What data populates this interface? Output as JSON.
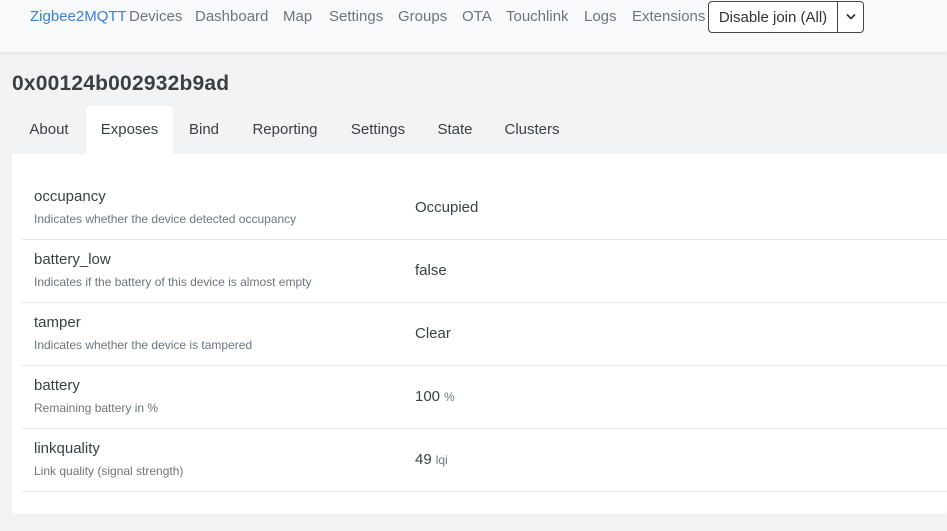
{
  "navbar": {
    "brand": "Zigbee2MQTT",
    "items": [
      "Devices",
      "Dashboard",
      "Map",
      "Settings",
      "Groups",
      "OTA",
      "Touchlink",
      "Logs",
      "Extensions"
    ],
    "join_button_label": "Disable join (All)",
    "join_caret_icon": "chevron-down-icon"
  },
  "device": {
    "title": "0x00124b002932b9ad"
  },
  "tabs": [
    "About",
    "Exposes",
    "Bind",
    "Reporting",
    "Settings",
    "State",
    "Clusters"
  ],
  "active_tab": "Exposes",
  "exposes": [
    {
      "name": "occupancy",
      "description": "Indicates whether the device detected occupancy",
      "value": "Occupied",
      "unit": ""
    },
    {
      "name": "battery_low",
      "description": "Indicates if the battery of this device is almost empty",
      "value": "false",
      "unit": ""
    },
    {
      "name": "tamper",
      "description": "Indicates whether the device is tampered",
      "value": "Clear",
      "unit": ""
    },
    {
      "name": "battery",
      "description": "Remaining battery in %",
      "value": "100",
      "unit": "%"
    },
    {
      "name": "linkquality",
      "description": "Link quality (signal strength)",
      "value": "49",
      "unit": "lqi"
    }
  ],
  "colors": {
    "brand": "#3d7fd3",
    "nav_text": "#6c757d",
    "page_background": "#f2f3f5",
    "panel_background": "#ffffff"
  }
}
